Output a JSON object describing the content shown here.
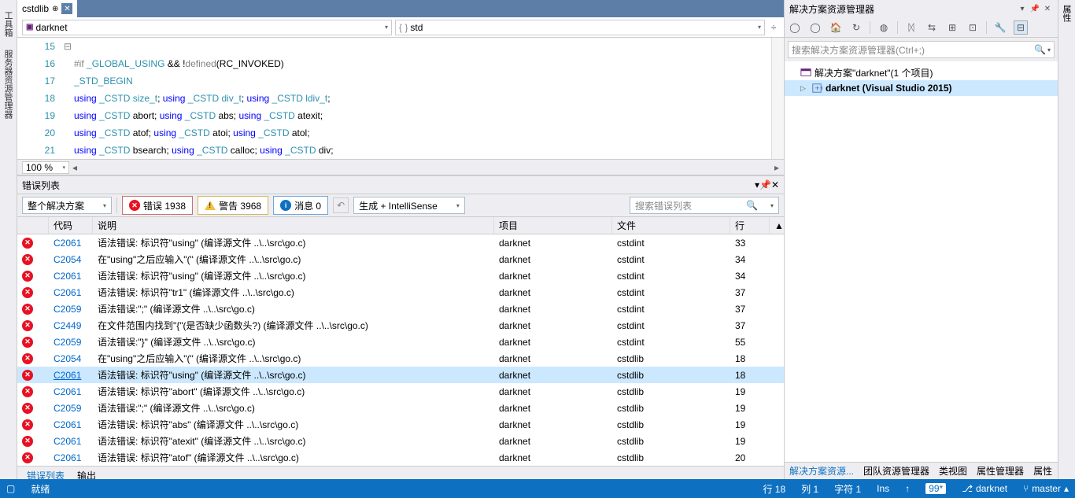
{
  "sidebar_left": [
    "工具箱",
    "服务器资源管理器"
  ],
  "sidebar_right": [
    "属性"
  ],
  "editor": {
    "tab_name": "cstdlib",
    "tab_suffix": "⏢ ⊕",
    "scope_combo": "darknet",
    "scope_icon": "⬚",
    "member_combo": "std",
    "member_prefix": "{ }",
    "zoom": "100 %",
    "lines": [
      {
        "n": 15,
        "html": ""
      },
      {
        "n": 16,
        "html": "<span class='pp'>#if</span> <span class='id'>_GLOBAL_USING</span> && !<span class='gray'>defined</span>(RC_INVOKED)"
      },
      {
        "n": 17,
        "html": "<span class='id'>_STD_BEGIN</span>"
      },
      {
        "n": 18,
        "html": "<span class='kw'>using</span> <span class='id'>_CSTD</span> <span class='id'>size_t</span>; <span class='kw'>using</span> <span class='id'>_CSTD</span> <span class='id'>div_t</span>; <span class='kw'>using</span> <span class='id'>_CSTD</span> <span class='id'>ldiv_t</span>;"
      },
      {
        "n": 19,
        "html": "<span class='kw'>using</span> <span class='id'>_CSTD</span> abort; <span class='kw'>using</span> <span class='id'>_CSTD</span> abs; <span class='kw'>using</span> <span class='id'>_CSTD</span> atexit;"
      },
      {
        "n": 20,
        "html": "<span class='kw'>using</span> <span class='id'>_CSTD</span> atof; <span class='kw'>using</span> <span class='id'>_CSTD</span> atoi; <span class='kw'>using</span> <span class='id'>_CSTD</span> atol;"
      },
      {
        "n": 21,
        "html": "<span class='kw'>using</span> <span class='id'>_CSTD</span> bsearch; <span class='kw'>using</span> <span class='id'>_CSTD</span> calloc; <span class='kw'>using</span> <span class='id'>_CSTD</span> div;"
      }
    ]
  },
  "solution_explorer": {
    "title": "解决方案资源管理器",
    "search_placeholder": "搜索解决方案资源管理器(Ctrl+;)",
    "root": "解决方案\"darknet\"(1 个项目)",
    "project": "darknet (Visual Studio 2015)",
    "tabs": [
      "解决方案资源...",
      "团队资源管理器",
      "类视图",
      "属性管理器",
      "属性"
    ]
  },
  "error_list": {
    "title": "错误列表",
    "scope": "整个解决方案",
    "errors_label": "错误 1938",
    "warnings_label": "警告 3968",
    "messages_label": "消息 0",
    "build_combo": "生成 + IntelliSense",
    "search_placeholder": "搜索错误列表",
    "headers": {
      "code": "代码",
      "desc": "说明",
      "proj": "项目",
      "file": "文件",
      "line": "行"
    },
    "rows": [
      {
        "code": "C2061",
        "desc": "语法错误: 标识符\"using\" (编译源文件 ..\\..\\src\\go.c)",
        "proj": "darknet",
        "file": "cstdint",
        "line": 33
      },
      {
        "code": "C2054",
        "desc": "在\"using\"之后应输入\"(\" (编译源文件 ..\\..\\src\\go.c)",
        "proj": "darknet",
        "file": "cstdint",
        "line": 34
      },
      {
        "code": "C2061",
        "desc": "语法错误: 标识符\"using\" (编译源文件 ..\\..\\src\\go.c)",
        "proj": "darknet",
        "file": "cstdint",
        "line": 34
      },
      {
        "code": "C2061",
        "desc": "语法错误: 标识符\"tr1\" (编译源文件 ..\\..\\src\\go.c)",
        "proj": "darknet",
        "file": "cstdint",
        "line": 37
      },
      {
        "code": "C2059",
        "desc": "语法错误:\";\" (编译源文件 ..\\..\\src\\go.c)",
        "proj": "darknet",
        "file": "cstdint",
        "line": 37
      },
      {
        "code": "C2449",
        "desc": "在文件范围内找到\"{\"(是否缺少函数头?) (编译源文件 ..\\..\\src\\go.c)",
        "proj": "darknet",
        "file": "cstdint",
        "line": 37
      },
      {
        "code": "C2059",
        "desc": "语法错误:\"}\" (编译源文件 ..\\..\\src\\go.c)",
        "proj": "darknet",
        "file": "cstdint",
        "line": 55
      },
      {
        "code": "C2054",
        "desc": "在\"using\"之后应输入\"(\" (编译源文件 ..\\..\\src\\go.c)",
        "proj": "darknet",
        "file": "cstdlib",
        "line": 18
      },
      {
        "code": "C2061",
        "desc": "语法错误: 标识符\"using\" (编译源文件 ..\\..\\src\\go.c)",
        "proj": "darknet",
        "file": "cstdlib",
        "line": 18,
        "selected": true
      },
      {
        "code": "C2061",
        "desc": "语法错误: 标识符\"abort\" (编译源文件 ..\\..\\src\\go.c)",
        "proj": "darknet",
        "file": "cstdlib",
        "line": 19
      },
      {
        "code": "C2059",
        "desc": "语法错误:\";\" (编译源文件 ..\\..\\src\\go.c)",
        "proj": "darknet",
        "file": "cstdlib",
        "line": 19
      },
      {
        "code": "C2061",
        "desc": "语法错误: 标识符\"abs\" (编译源文件 ..\\..\\src\\go.c)",
        "proj": "darknet",
        "file": "cstdlib",
        "line": 19
      },
      {
        "code": "C2061",
        "desc": "语法错误: 标识符\"atexit\" (编译源文件 ..\\..\\src\\go.c)",
        "proj": "darknet",
        "file": "cstdlib",
        "line": 19
      },
      {
        "code": "C2061",
        "desc": "语法错误: 标识符\"atof\" (编译源文件 ..\\..\\src\\go.c)",
        "proj": "darknet",
        "file": "cstdlib",
        "line": 20
      }
    ],
    "bottom_tabs": [
      "错误列表",
      "输出"
    ]
  },
  "status": {
    "ready": "就绪",
    "line": "行 18",
    "col": "列 1",
    "char": "字符 1",
    "ins": "Ins",
    "badge": "99*",
    "branch": "darknet",
    "master": "master"
  }
}
